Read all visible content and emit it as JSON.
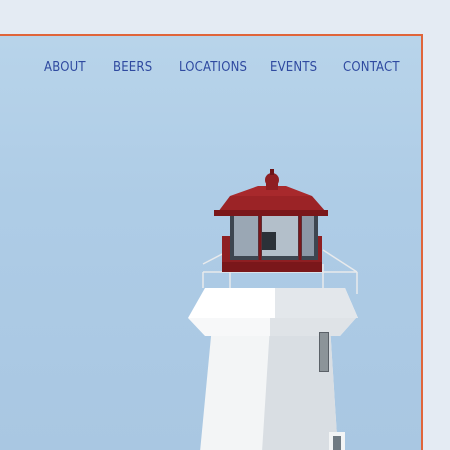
{
  "nav": {
    "items": [
      {
        "label": "ABOUT"
      },
      {
        "label": "BEERS"
      },
      {
        "label": "LOCATIONS"
      },
      {
        "label": "EVENTS"
      },
      {
        "label": "CONTACT"
      }
    ]
  },
  "hero": {
    "image": "lighthouse-photo"
  },
  "colors": {
    "accent_border": "#e0653a",
    "nav_text": "#2f4aa0",
    "sky": "#b5d1e8",
    "page_bg": "#e4ebf3",
    "lantern_red": "#8e1f22"
  }
}
